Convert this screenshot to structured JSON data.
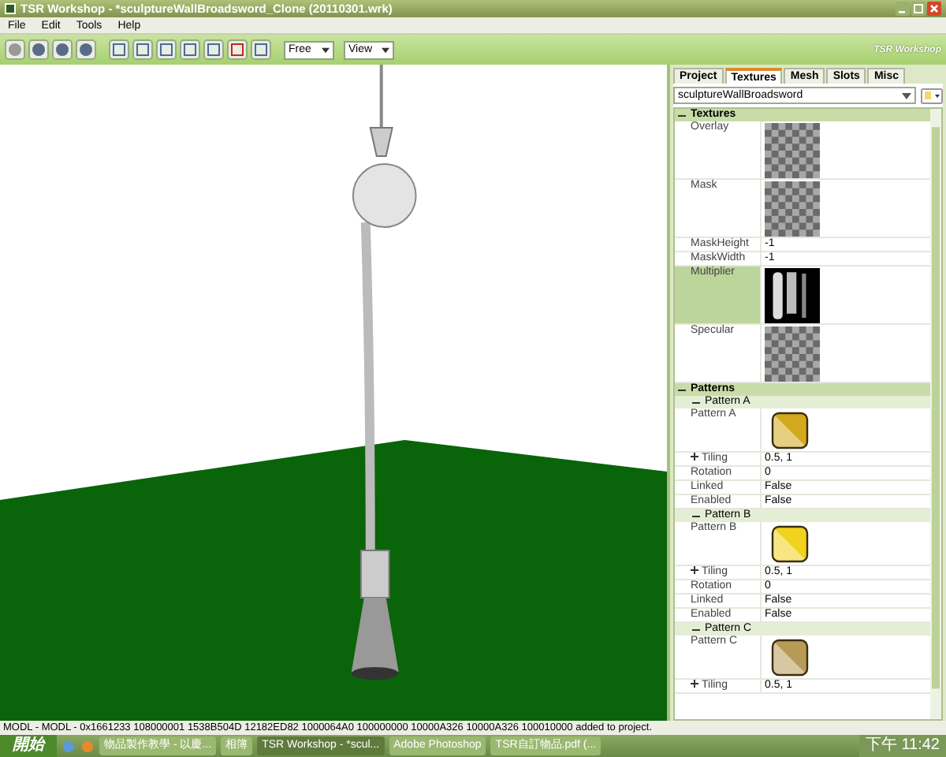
{
  "window": {
    "title": "TSR Workshop - *sculptureWallBroadsword_Clone (20110301.wrk)"
  },
  "menu": [
    "File",
    "Edit",
    "Tools",
    "Help"
  ],
  "toolbar": {
    "dropdowns": [
      {
        "value": "Free"
      },
      {
        "value": "View"
      }
    ]
  },
  "logo": {
    "text": "TSR Workshop"
  },
  "tabs": [
    {
      "label": "Project",
      "selected": false
    },
    {
      "label": "Textures",
      "selected": true
    },
    {
      "label": "Mesh",
      "selected": false
    },
    {
      "label": "Slots",
      "selected": false
    },
    {
      "label": "Misc",
      "selected": false
    }
  ],
  "resource_select": {
    "value": "sculptureWallBroadsword"
  },
  "properties": [
    {
      "label": "Textures",
      "expanded": true,
      "children": [
        {
          "kind": "empty",
          "label": "Overlay",
          "selected": false
        },
        {
          "kind": "empty",
          "label": "Mask",
          "selected": false
        },
        {
          "kind": "value",
          "label": "MaskHeight",
          "value": "-1",
          "selected": false
        },
        {
          "kind": "value",
          "label": "MaskWidth",
          "value": "-1",
          "selected": false
        },
        {
          "kind": "texture",
          "label": "Multiplier",
          "selected": true
        },
        {
          "kind": "empty",
          "label": "Specular",
          "selected": false
        }
      ]
    },
    {
      "label": "Patterns",
      "expanded": true,
      "children": [
        {
          "label": "Pattern A",
          "expanded": true,
          "children": [
            {
              "kind": "pattern",
              "label": "Pattern A",
              "color": "#d4a81c",
              "selected": false
            },
            {
              "kind": "value",
              "label": "Tiling",
              "value": "0.5, 1",
              "expanded": false,
              "selected": false
            },
            {
              "kind": "value",
              "label": "Rotation",
              "value": "0",
              "selected": false
            },
            {
              "kind": "value",
              "label": "Linked",
              "value": "False",
              "selected": false
            },
            {
              "kind": "value",
              "label": "Enabled",
              "value": "False",
              "selected": false
            }
          ]
        },
        {
          "label": "Pattern B",
          "expanded": true,
          "children": [
            {
              "kind": "pattern",
              "label": "Pattern B",
              "color": "#f1d21c",
              "selected": false
            },
            {
              "kind": "value",
              "label": "Tiling",
              "value": "0.5, 1",
              "expanded": false,
              "selected": false
            },
            {
              "kind": "value",
              "label": "Rotation",
              "value": "0",
              "selected": false
            },
            {
              "kind": "value",
              "label": "Linked",
              "value": "False",
              "selected": false
            },
            {
              "kind": "value",
              "label": "Enabled",
              "value": "False",
              "selected": false
            }
          ]
        },
        {
          "label": "Pattern C",
          "expanded": true,
          "children": [
            {
              "kind": "pattern",
              "label": "Pattern C",
              "color": "#b89a58",
              "selected": false
            },
            {
              "kind": "value",
              "label": "Tiling",
              "value": "0.5, 1",
              "expanded": false,
              "selected": false
            }
          ]
        }
      ]
    }
  ],
  "status_bar": "MODL - MODL - 0x1661233 108000001 1538B504D 12182ED82 1000064A0 100000000 10000A326 10000A326 100010000 added to project.",
  "taskbar": {
    "start": "開始",
    "items": [
      {
        "label": "物品製作教學 - 以慶...",
        "selected": false
      },
      {
        "label": "相簿",
        "selected": false
      },
      {
        "label": "TSR Workshop - *scul...",
        "selected": true
      },
      {
        "label": "Adobe Photoshop",
        "selected": false
      },
      {
        "label": "TSR自訂物品.pdf (...",
        "selected": false
      }
    ],
    "clock": "下午 11:42"
  }
}
